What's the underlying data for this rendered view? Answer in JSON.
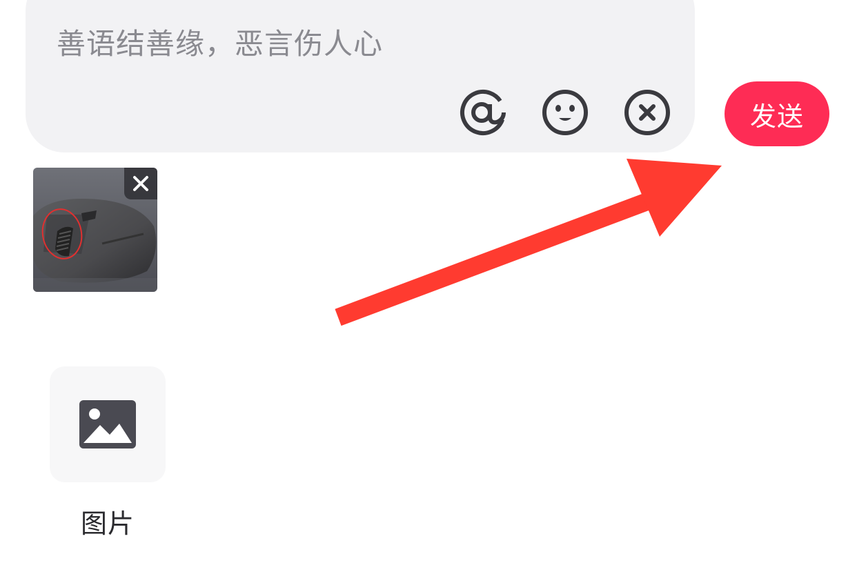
{
  "composer": {
    "placeholder": "善语结善缘，恶言伤人心",
    "at_icon": "at-icon",
    "emoji_icon": "smiley-icon",
    "clear_icon": "clear-circle-icon"
  },
  "send": {
    "label": "发送",
    "color": "#fe2c55"
  },
  "attachment": {
    "remove_icon": "close-icon",
    "image": "photo-of-computer-mouse"
  },
  "tools": {
    "image_label": "图片",
    "image_icon": "image-icon"
  },
  "annotation": {
    "arrow_color": "#ff3b30"
  }
}
